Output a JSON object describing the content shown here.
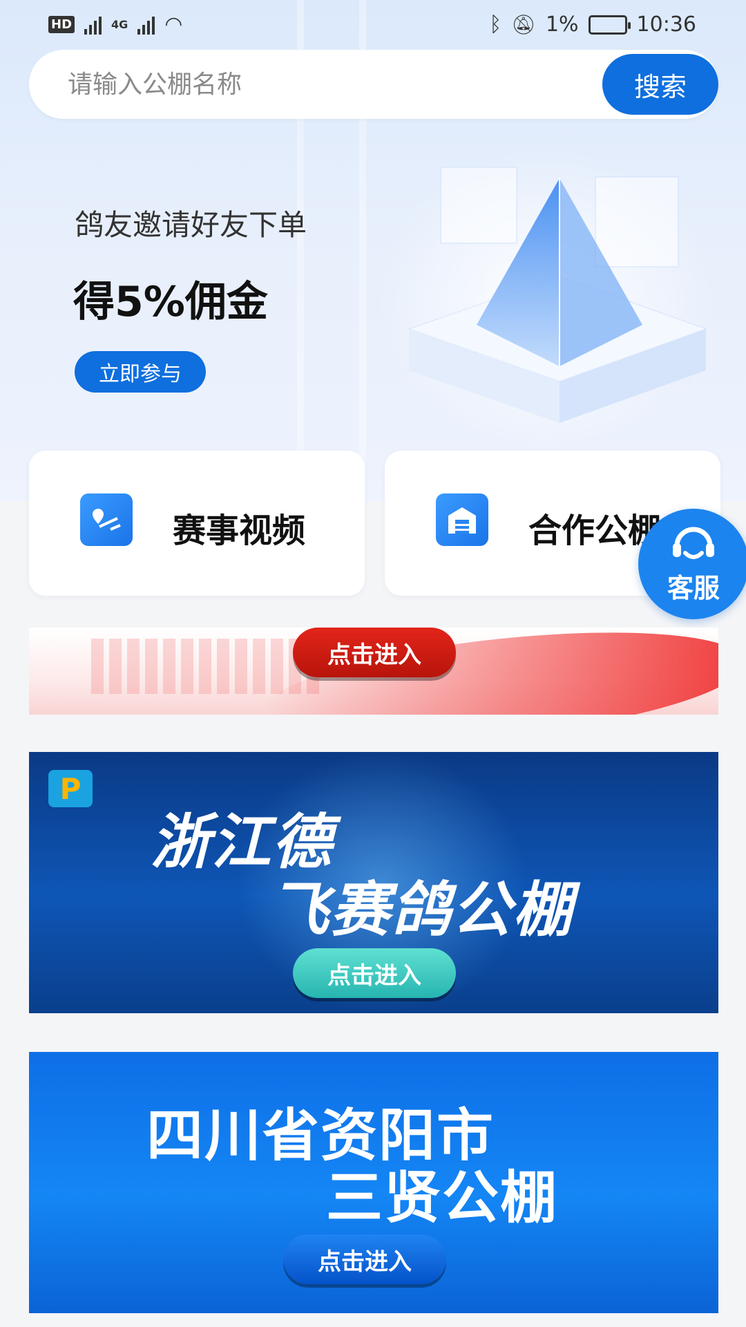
{
  "status_bar": {
    "left_badge": "HD",
    "network": "4G",
    "battery": "1%",
    "time": "10:36"
  },
  "search": {
    "placeholder": "请输入公棚名称",
    "button_label": "搜索"
  },
  "promo": {
    "subtitle": "鸽友邀请好友下单",
    "title": "得5%佣金",
    "button_label": "立即参与"
  },
  "cards": [
    {
      "label": "赛事视频",
      "icon": "map-route-icon"
    },
    {
      "label": "合作公棚",
      "icon": "warehouse-icon"
    }
  ],
  "service": {
    "label": "客服",
    "icon": "headset-icon"
  },
  "banners": [
    {
      "enter_label": "点击进入",
      "color": "#e2251a"
    },
    {
      "line1": "浙江德",
      "line2": "飞赛鸽公棚",
      "enter_label": "点击进入",
      "color": "#27b5b0"
    },
    {
      "line1": "四川省资阳市",
      "line2": "三贤公棚",
      "enter_label": "点击进入",
      "color": "#0552c9"
    }
  ],
  "colors": {
    "accent": "#0f6fde"
  }
}
